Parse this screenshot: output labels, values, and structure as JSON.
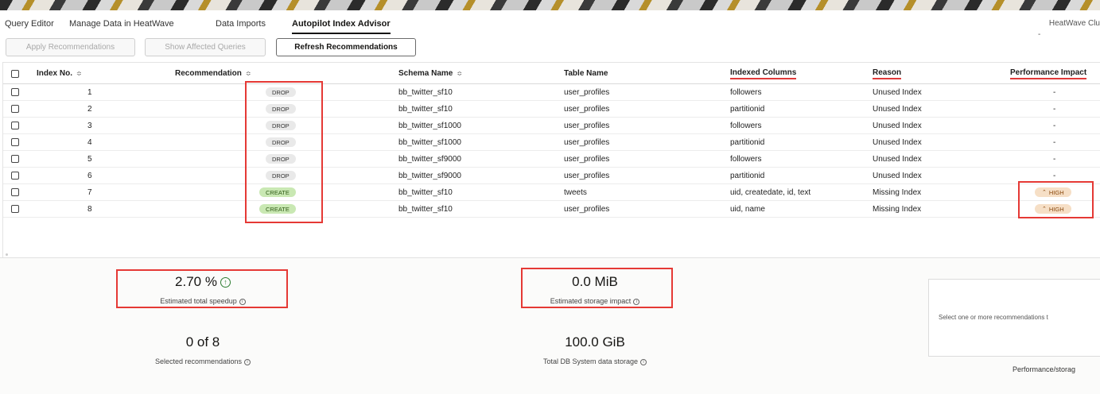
{
  "tabs": [
    {
      "label": "Query Editor",
      "active": false
    },
    {
      "label": "Manage Data in HeatWave",
      "active": false
    },
    {
      "label": "Data Imports",
      "active": false
    },
    {
      "label": "Autopilot Index Advisor",
      "active": true
    }
  ],
  "cluster": {
    "label": "HeatWave Clu",
    "value": "-"
  },
  "toolbar": {
    "apply_label": "Apply Recommendations",
    "affected_label": "Show Affected Queries",
    "refresh_label": "Refresh Recommendations"
  },
  "table": {
    "headers": {
      "index_no": "Index No.",
      "recommendation": "Recommendation",
      "schema_name": "Schema Name",
      "table_name": "Table Name",
      "indexed_columns": "Indexed Columns",
      "reason": "Reason",
      "performance_impact": "Performance Impact"
    },
    "sort_icon": "sort-icon",
    "rows": [
      {
        "index": "1",
        "recommendation": "DROP",
        "schema": "bb_twitter_sf10",
        "table": "user_profiles",
        "columns": "followers",
        "reason": "Unused Index",
        "impact": "-"
      },
      {
        "index": "2",
        "recommendation": "DROP",
        "schema": "bb_twitter_sf10",
        "table": "user_profiles",
        "columns": "partitionid",
        "reason": "Unused Index",
        "impact": "-"
      },
      {
        "index": "3",
        "recommendation": "DROP",
        "schema": "bb_twitter_sf1000",
        "table": "user_profiles",
        "columns": "followers",
        "reason": "Unused Index",
        "impact": "-"
      },
      {
        "index": "4",
        "recommendation": "DROP",
        "schema": "bb_twitter_sf1000",
        "table": "user_profiles",
        "columns": "partitionid",
        "reason": "Unused Index",
        "impact": "-"
      },
      {
        "index": "5",
        "recommendation": "DROP",
        "schema": "bb_twitter_sf9000",
        "table": "user_profiles",
        "columns": "followers",
        "reason": "Unused Index",
        "impact": "-"
      },
      {
        "index": "6",
        "recommendation": "DROP",
        "schema": "bb_twitter_sf9000",
        "table": "user_profiles",
        "columns": "partitionid",
        "reason": "Unused Index",
        "impact": "-"
      },
      {
        "index": "7",
        "recommendation": "CREATE",
        "schema": "bb_twitter_sf10",
        "table": "tweets",
        "columns": "uid, createdate, id, text",
        "reason": "Missing Index",
        "impact": "HIGH"
      },
      {
        "index": "8",
        "recommendation": "CREATE",
        "schema": "bb_twitter_sf10",
        "table": "user_profiles",
        "columns": "uid, name",
        "reason": "Missing Index",
        "impact": "HIGH"
      }
    ]
  },
  "metrics": {
    "speedup": {
      "value": "2.70 %",
      "label": "Estimated total speedup"
    },
    "storage": {
      "value": "0.0 MiB",
      "label": "Estimated storage impact"
    },
    "selected": {
      "value": "0 of 8",
      "label": "Selected recommendations"
    },
    "total": {
      "value": "100.0 GiB",
      "label": "Total DB System data storage"
    }
  },
  "side_panel": {
    "message": "Select one or more recommendations t",
    "caption": "Performance/storag"
  },
  "colors": {
    "annotation": "#e53935",
    "create": "#c9e8b3",
    "high": "#f6dfc6",
    "speedup_arrow": "#2e7d32"
  }
}
